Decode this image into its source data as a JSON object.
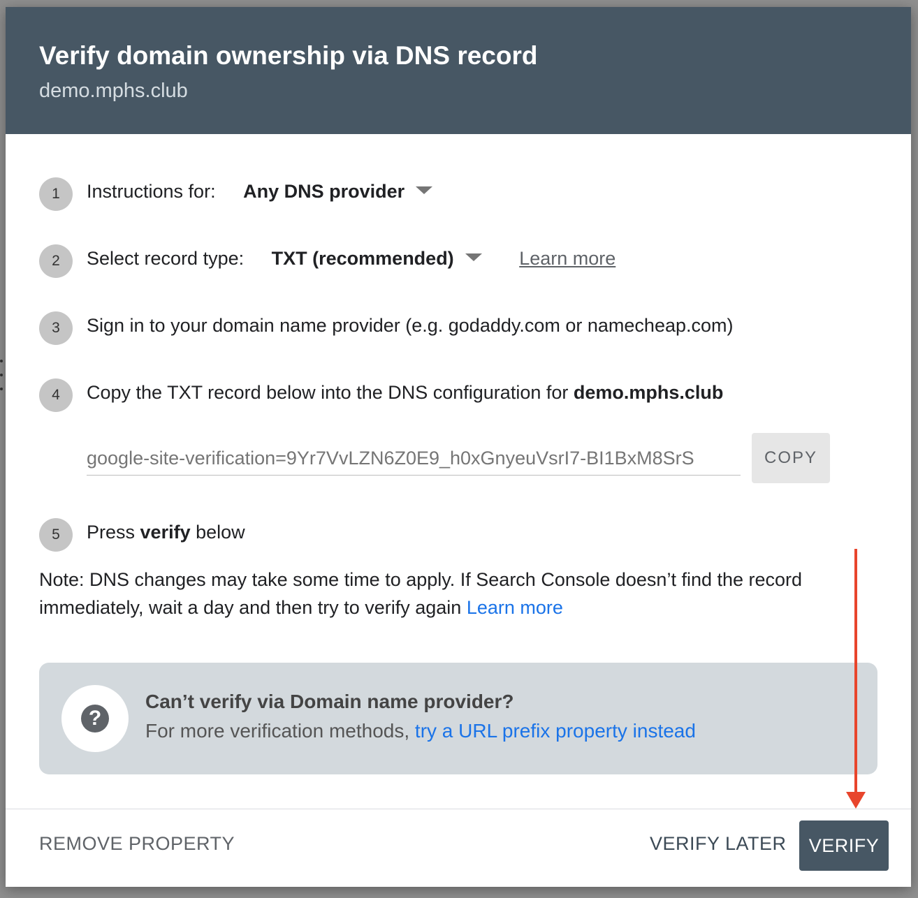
{
  "dialog": {
    "title": "Verify domain ownership via DNS record",
    "subtitle": "demo.mphs.club"
  },
  "steps": [
    {
      "num": "1",
      "label": "Instructions for:",
      "select_value": "Any DNS provider"
    },
    {
      "num": "2",
      "label": "Select record type:",
      "select_value": "TXT (recommended)",
      "link": "Learn more"
    },
    {
      "num": "3",
      "text": "Sign in to your domain name provider (e.g. godaddy.com or namecheap.com)"
    },
    {
      "num": "4",
      "text": "Copy the TXT record below into the DNS configuration for ",
      "domain": "demo.mphs.club"
    },
    {
      "num": "5",
      "text_pre": "Press ",
      "text_bold": "verify",
      "text_post": " below"
    }
  ],
  "record": {
    "value": "google-site-verification=9Yr7VvLZN6Z0E9_h0xGnyeuVsrI7-BI1BxM8SrS",
    "copy_label": "COPY"
  },
  "note": {
    "text": "Note: DNS changes may take some time to apply. If Search Console doesn’t find the record immediately, wait a day and then try to verify again ",
    "link": "Learn more"
  },
  "info": {
    "title": "Can’t verify via Domain name provider?",
    "text": "For more verification methods, ",
    "link": "try a URL prefix property instead",
    "icon": "help-icon"
  },
  "footer": {
    "remove": "REMOVE PROPERTY",
    "verify_later": "VERIFY LATER",
    "verify": "VERIFY"
  },
  "colors": {
    "header": "#475764",
    "link": "#1a73e8",
    "annotation_arrow": "#e8452c"
  }
}
